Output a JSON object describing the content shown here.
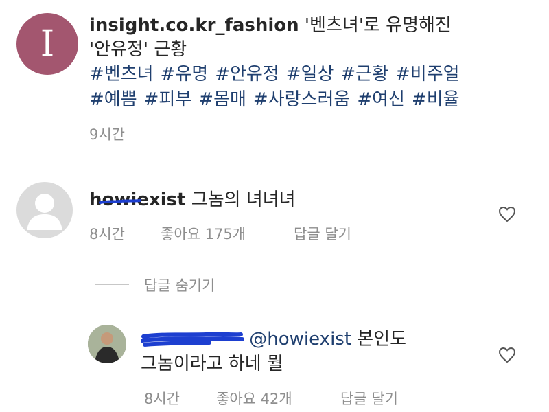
{
  "post": {
    "avatar_letter": "I",
    "username": "insight.co.kr_fashion",
    "caption_line1": "'벤츠녀'로 유명해진",
    "caption_line2": "'안유정' 근황",
    "hashtags_line1": [
      "#벤츠녀",
      "#유명",
      "#안유정",
      "#일상",
      "#근황",
      "#비주얼"
    ],
    "hashtags_line2": [
      "#예쁨",
      "#피부",
      "#몸매",
      "#사랑스러움",
      "#여신",
      "#비율"
    ],
    "time": "9시간"
  },
  "comment": {
    "username": "howiexist",
    "text": "그놈의 녀녀녀",
    "time": "8시간",
    "likes": "좋아요 175개",
    "reply_label": "답글 달기",
    "hide_replies": "답글 숨기기"
  },
  "reply": {
    "mention": "@howiexist",
    "text_line1": "본인도",
    "text_line2": "그놈이라고 하네 뭘",
    "time": "8시간",
    "likes": "좋아요 42개",
    "reply_label": "답글 달기"
  },
  "icons": {
    "heart": "heart-outline-icon",
    "default_avatar": "person-silhouette-icon"
  },
  "colors": {
    "brand_avatar": "#a3566f",
    "link_blue": "#1f3f6f",
    "meta_gray": "#8e8e8e",
    "scribble": "#1d3fd0"
  }
}
